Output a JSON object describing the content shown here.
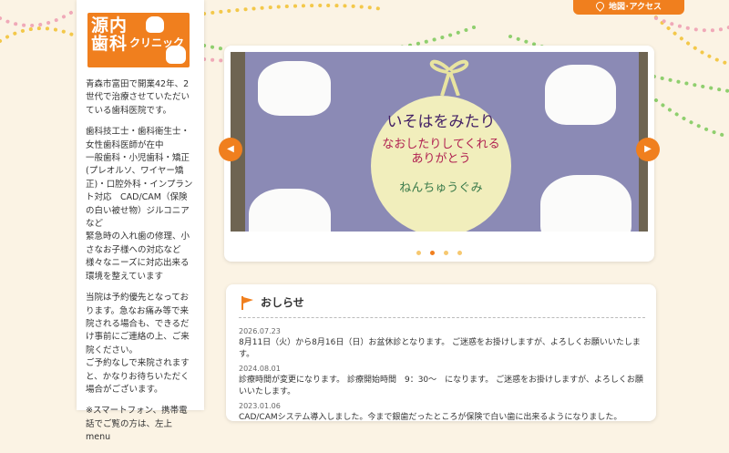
{
  "clinic": {
    "logo_kanji": "源内歯科",
    "logo_clinic": "クリニック"
  },
  "access_button": {
    "label": "地図･アクセス",
    "icon": "map-pin-icon"
  },
  "sidebar": {
    "paragraphs": [
      "青森市富田で開業42年、2世代で治療させていただいている歯科医院です。",
      "歯科技工士・歯科衛生士・女性歯科医師が在中\n一般歯科・小児歯科・矯正(プレオルソ、ワイヤー矯正)・口腔外科・インプラント対応　CAD/CAM（保険の白い被せ物）ジルコニアなど\n緊急時の入れ歯の修理、小さなお子様への対応など様々なニーズに対応出来る環境を整えています",
      "当院は予約優先となっております。急なお痛み等で来院される場合も、できるだけ事前にご連絡の上、ご来院ください。\nご予約なしで来院されますと、かなりお待ちいただく場合がございます。",
      "※スマートフォン、携帯電話でご覧の方は、左上　menu"
    ]
  },
  "slider": {
    "slide_text": {
      "line1": "いそはをみたり",
      "line2": "なおしたりしてくれる",
      "line3": "ありがとう",
      "line4": "ねんちゅうぐみ"
    },
    "prev_icon": "chevron-left-icon",
    "next_icon": "chevron-right-icon",
    "pagination_count": 4,
    "active_index": 1
  },
  "news": {
    "title": "おしらせ",
    "icon": "flag-icon",
    "items": [
      {
        "date": "2026.07.23",
        "text": "8月11日（火）から8月16日（日）お盆休診となります。 ご迷惑をお掛けしますが、よろしくお願いいたします。"
      },
      {
        "date": "2024.08.01",
        "text": "診療時間が変更になります。 診療開始時間　9：30〜　になります。 ご迷惑をお掛けしますが、よろしくお願いいたします。"
      },
      {
        "date": "2023.01.06",
        "text": "CAD/CAMシステム導入しました。今まで銀歯だったところが保険で白い歯に出来るようになりました。"
      }
    ]
  },
  "colors": {
    "accent": "#f07f1e",
    "background": "#fbf3e4"
  }
}
